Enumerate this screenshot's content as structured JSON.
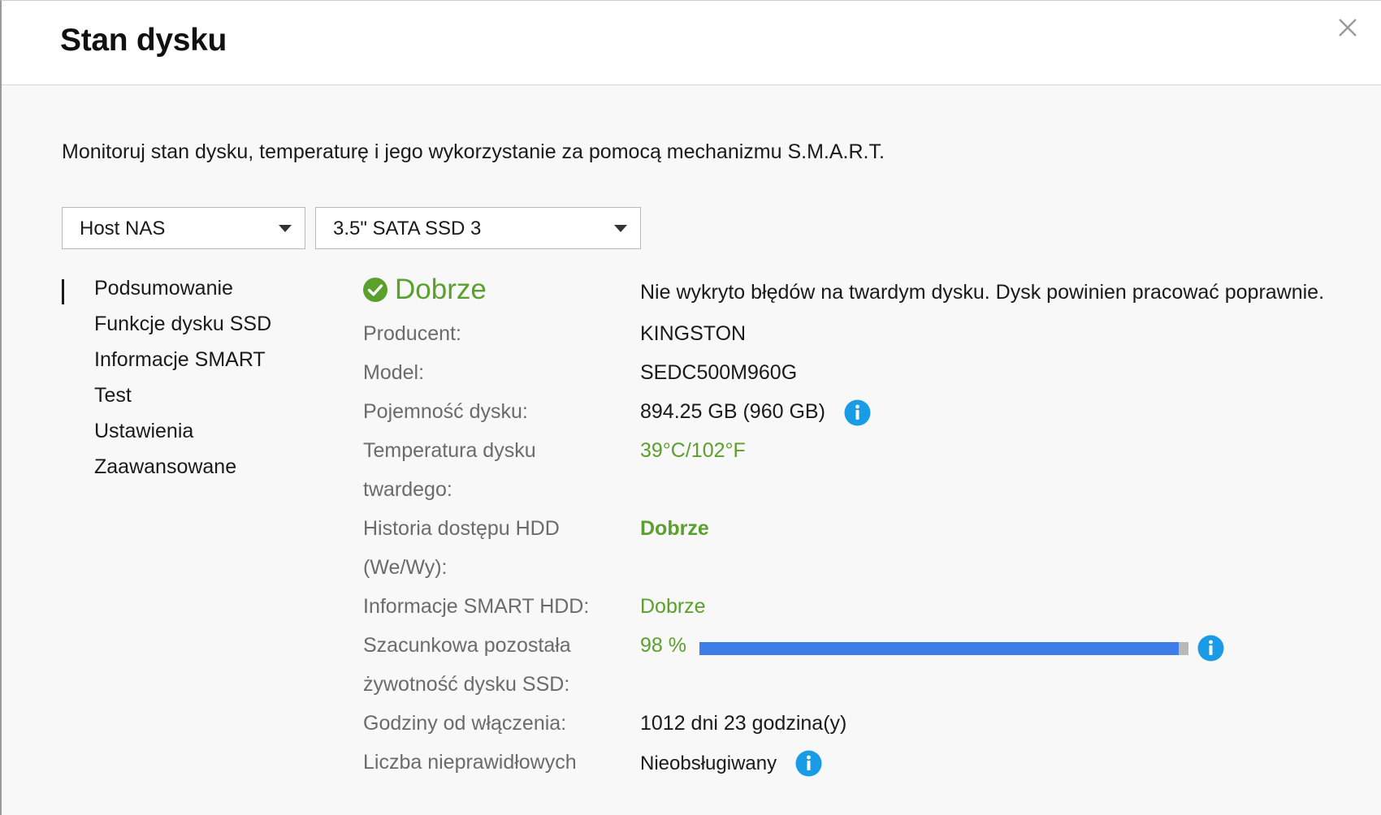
{
  "dialog": {
    "title": "Stan dysku",
    "description": "Monitoruj stan dysku, temperaturę i jego wykorzystanie za pomocą mechanizmu S.M.A.R.T."
  },
  "selectors": {
    "host": "Host NAS",
    "disk": "3.5\" SATA SSD 3"
  },
  "nav": {
    "items": [
      "Podsumowanie",
      "Funkcje dysku SSD",
      "Informacje SMART",
      "Test",
      "Ustawienia",
      "Zaawansowane"
    ],
    "active_index": 0
  },
  "summary": {
    "status": "Dobrze",
    "status_message": "Nie wykryto błędów na twardym dysku. Dysk powinien pracować poprawnie.",
    "manufacturer_label": "Producent:",
    "manufacturer": "KINGSTON",
    "model_label": "Model:",
    "model": "SEDC500M960G",
    "capacity_label": "Pojemność dysku:",
    "capacity": "894.25 GB (960 GB)",
    "temperature_label_1": "Temperatura dysku",
    "temperature_label_2": "twardego:",
    "temperature": "39°C/102°F",
    "access_history_label_1": "Historia dostępu HDD",
    "access_history_label_2": "(We/Wy):",
    "access_history": "Dobrze",
    "smart_label": "Informacje SMART HDD:",
    "smart": "Dobrze",
    "life_label_1": "Szacunkowa pozostała",
    "life_label_2": "żywotność dysku SSD:",
    "life": "98 %",
    "life_fraction": 0.98,
    "power_on_label": "Godziny od włączenia:",
    "power_on": "1012 dni 23 godzina(y)",
    "bad_sectors_label": "Liczba nieprawidłowych",
    "bad_sectors": "Nieobsługiwany"
  },
  "colors": {
    "good": "#5aa02c",
    "progress": "#3e7ce8",
    "info": "#1a9be6"
  }
}
